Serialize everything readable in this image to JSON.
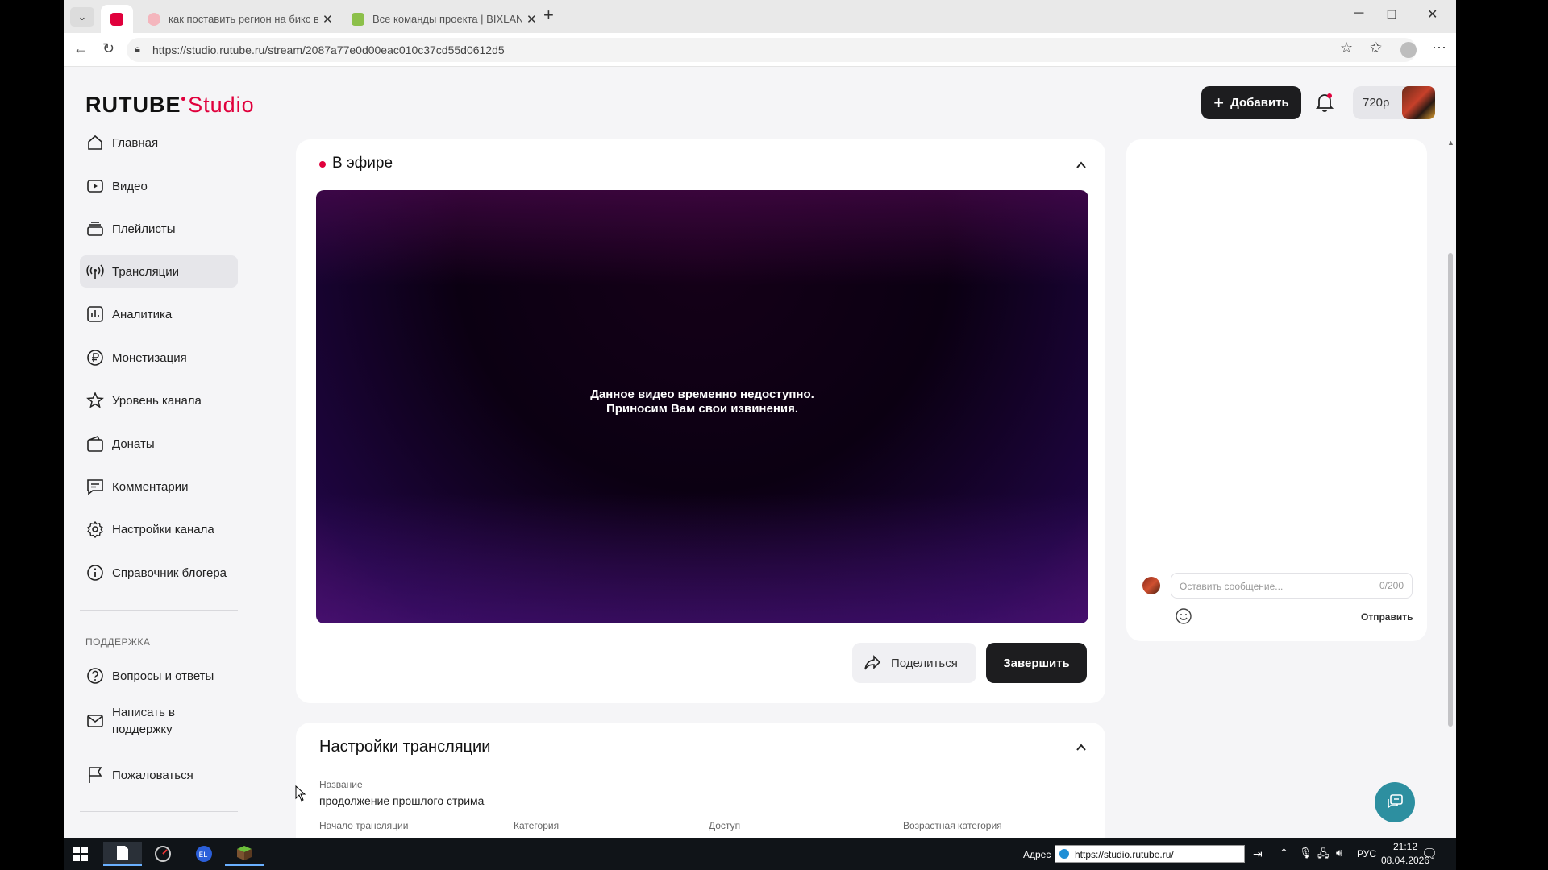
{
  "browser": {
    "tabs": [
      {
        "title": "",
        "active": true
      },
      {
        "title": "как поставить регион на бикс во",
        "active": false
      },
      {
        "title": "Все команды проекта | BIXLAND",
        "active": false
      }
    ],
    "url": "https://studio.rutube.ru/stream/2087a77e0d00eac010c37cd55d0612d5"
  },
  "header": {
    "logo_main": "RUTUBE",
    "logo_dot": "•",
    "logo_studio": "Studio",
    "add_label": "Добавить",
    "quality": "720p"
  },
  "sidebar": {
    "items": [
      {
        "label": "Главная",
        "icon": "home-icon"
      },
      {
        "label": "Видео",
        "icon": "video-icon"
      },
      {
        "label": "Плейлисты",
        "icon": "playlist-icon"
      },
      {
        "label": "Трансляции",
        "icon": "broadcast-icon"
      },
      {
        "label": "Аналитика",
        "icon": "analytics-icon"
      },
      {
        "label": "Монетизация",
        "icon": "ruble-icon"
      },
      {
        "label": "Уровень канала",
        "icon": "star-icon"
      },
      {
        "label": "Донаты",
        "icon": "wallet-icon"
      },
      {
        "label": "Комментарии",
        "icon": "comment-icon"
      },
      {
        "label": "Настройки канала",
        "icon": "gear-icon"
      },
      {
        "label": "Справочник блогера",
        "icon": "info-icon"
      }
    ],
    "support_heading": "ПОДДЕРЖКА",
    "support_items": [
      {
        "label": "Вопросы и ответы",
        "icon": "question-icon"
      },
      {
        "label": "Написать в поддержку",
        "icon": "mail-icon"
      },
      {
        "label": "Пожаловаться",
        "icon": "flag-icon"
      }
    ]
  },
  "live": {
    "title": "В эфире",
    "message_line1": "Данное видео временно недоступно.",
    "message_line2": "Приносим Вам свои извинения.",
    "share_label": "Поделиться",
    "end_label": "Завершить"
  },
  "chat": {
    "placeholder": "Оставить сообщение...",
    "counter": "0/200",
    "send_label": "Отправить"
  },
  "settings": {
    "title": "Настройки трансляции",
    "name_label": "Название",
    "name_value": "продолжение прошлого стрима",
    "fields": [
      "Начало трансляции",
      "Категория",
      "Доступ",
      "Возрастная категория"
    ]
  },
  "taskbar": {
    "address_label": "Адрес",
    "address_value": "https://studio.rutube.ru/",
    "lang": "РУС",
    "time": "21:12",
    "date": "08.04.2026"
  }
}
